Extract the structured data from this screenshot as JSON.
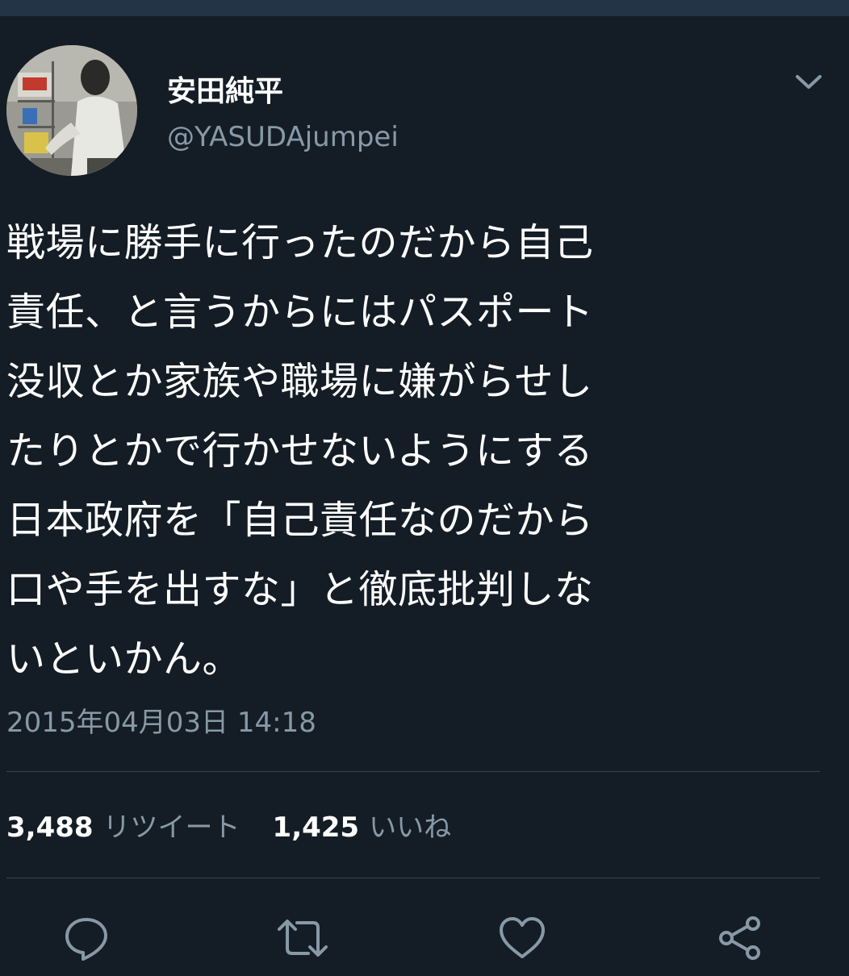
{
  "tweet": {
    "display_name": "安田純平",
    "handle": "@YASUDAjumpei",
    "text": "戦場に勝手に行ったのだから自己\n責任、と言うからにはパスポート\n没収とか家族や職場に嫌がらせし\nたりとかで行かせないようにする\n日本政府を「自己責任なのだから\n口や手を出すな」と徹底批判しな\nいといかん。",
    "timestamp": "2015年04月03日 14:18"
  },
  "stats": {
    "retweets_count": "3,488",
    "retweets_label": "リツイート",
    "likes_count": "1,425",
    "likes_label": "いいね"
  },
  "icons": {
    "more": "chevron-down-icon",
    "reply": "reply-icon",
    "retweet": "retweet-icon",
    "like": "heart-icon",
    "share": "share-icon"
  },
  "colors": {
    "background": "#141d26",
    "text": "#ffffff",
    "secondary": "#8899a6",
    "divider": "#38444d"
  }
}
